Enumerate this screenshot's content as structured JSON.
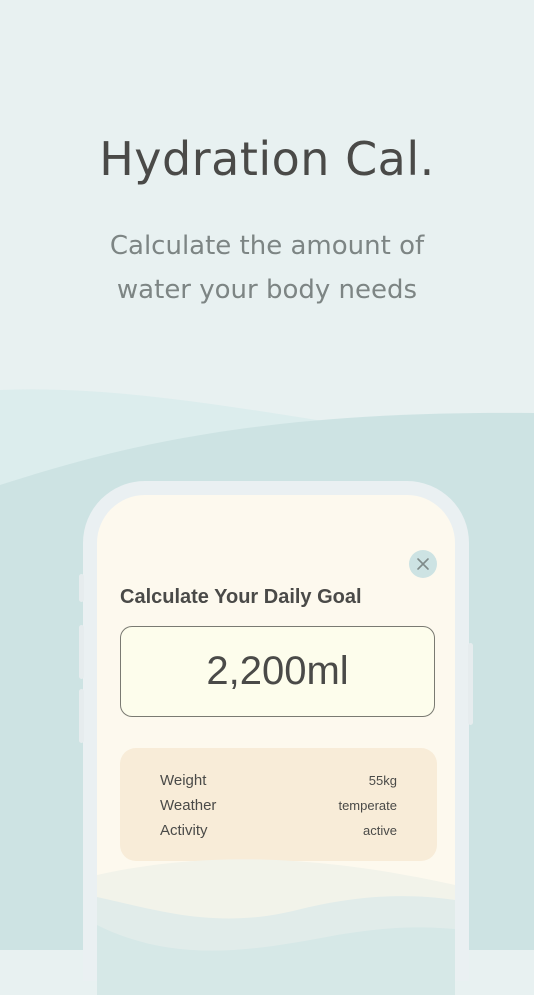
{
  "hero": {
    "title": "Hydration Cal.",
    "subtitle": "Calculate the amount of\nwater your body needs"
  },
  "screen": {
    "close_icon": "close-icon",
    "heading": "Calculate Your Daily Goal",
    "amount": "2,200ml",
    "details": [
      {
        "label": "Weight",
        "value": "55kg"
      },
      {
        "label": "Weather",
        "value": "temperate"
      },
      {
        "label": "Activity",
        "value": "active"
      }
    ]
  },
  "colors": {
    "background": "#e8f1f1",
    "wave_light": "#dceded",
    "wave_main": "#cde3e3",
    "phone_frame": "#eaf0f2",
    "screen_bg": "#fdf9ee",
    "card_bg": "#f8ecd8",
    "amount_bg": "#fdfdec",
    "text_dark": "#4a4a48",
    "text_muted": "#7d8584"
  }
}
